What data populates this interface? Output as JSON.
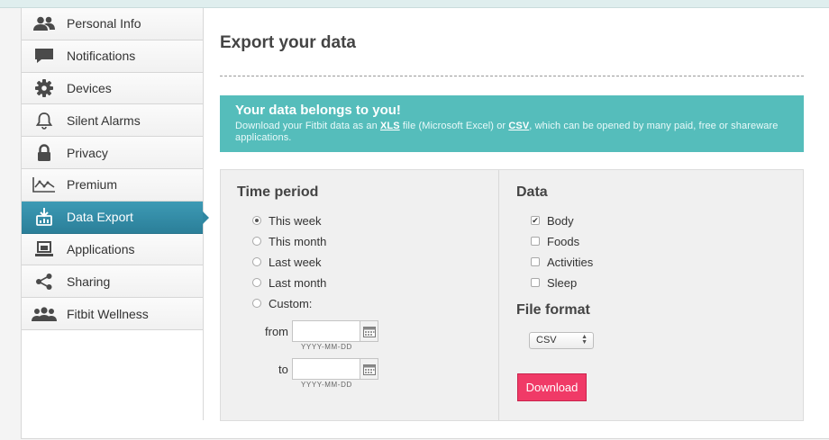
{
  "sidebar": {
    "items": [
      {
        "label": "Personal Info",
        "icon": "people-icon"
      },
      {
        "label": "Notifications",
        "icon": "speech-bubble-icon"
      },
      {
        "label": "Devices",
        "icon": "gear-icon"
      },
      {
        "label": "Silent Alarms",
        "icon": "bell-icon"
      },
      {
        "label": "Privacy",
        "icon": "lock-icon"
      },
      {
        "label": "Premium",
        "icon": "chart-line-icon"
      },
      {
        "label": "Data Export",
        "icon": "download-icon",
        "active": true
      },
      {
        "label": "Applications",
        "icon": "laptop-icon"
      },
      {
        "label": "Sharing",
        "icon": "share-icon"
      },
      {
        "label": "Fitbit Wellness",
        "icon": "group-icon"
      }
    ]
  },
  "main": {
    "title": "Export your data",
    "banner": {
      "heading": "Your data belongs to you!",
      "text_1": "Download your Fitbit data as an ",
      "xls": "XLS",
      "text_2": " file (Microsoft Excel) or ",
      "csv": "CSV",
      "text_3": ", which can be opened by many paid, free or shareware applications."
    },
    "time_period": {
      "title": "Time period",
      "options": [
        "This week",
        "This month",
        "Last week",
        "Last month",
        "Custom:"
      ],
      "selected": "This week",
      "from_label": "from",
      "to_label": "to",
      "date_placeholder": "YYYY-MM-DD"
    },
    "data": {
      "title": "Data",
      "options": [
        {
          "label": "Body",
          "checked": true
        },
        {
          "label": "Foods",
          "checked": false
        },
        {
          "label": "Activities",
          "checked": false
        },
        {
          "label": "Sleep",
          "checked": false
        }
      ]
    },
    "file_format": {
      "title": "File format",
      "selected": "CSV"
    },
    "download_label": "Download"
  },
  "colors": {
    "accent_teal": "#55bdbb",
    "active_nav": "#2f87a2",
    "download_button": "#f03a67"
  }
}
